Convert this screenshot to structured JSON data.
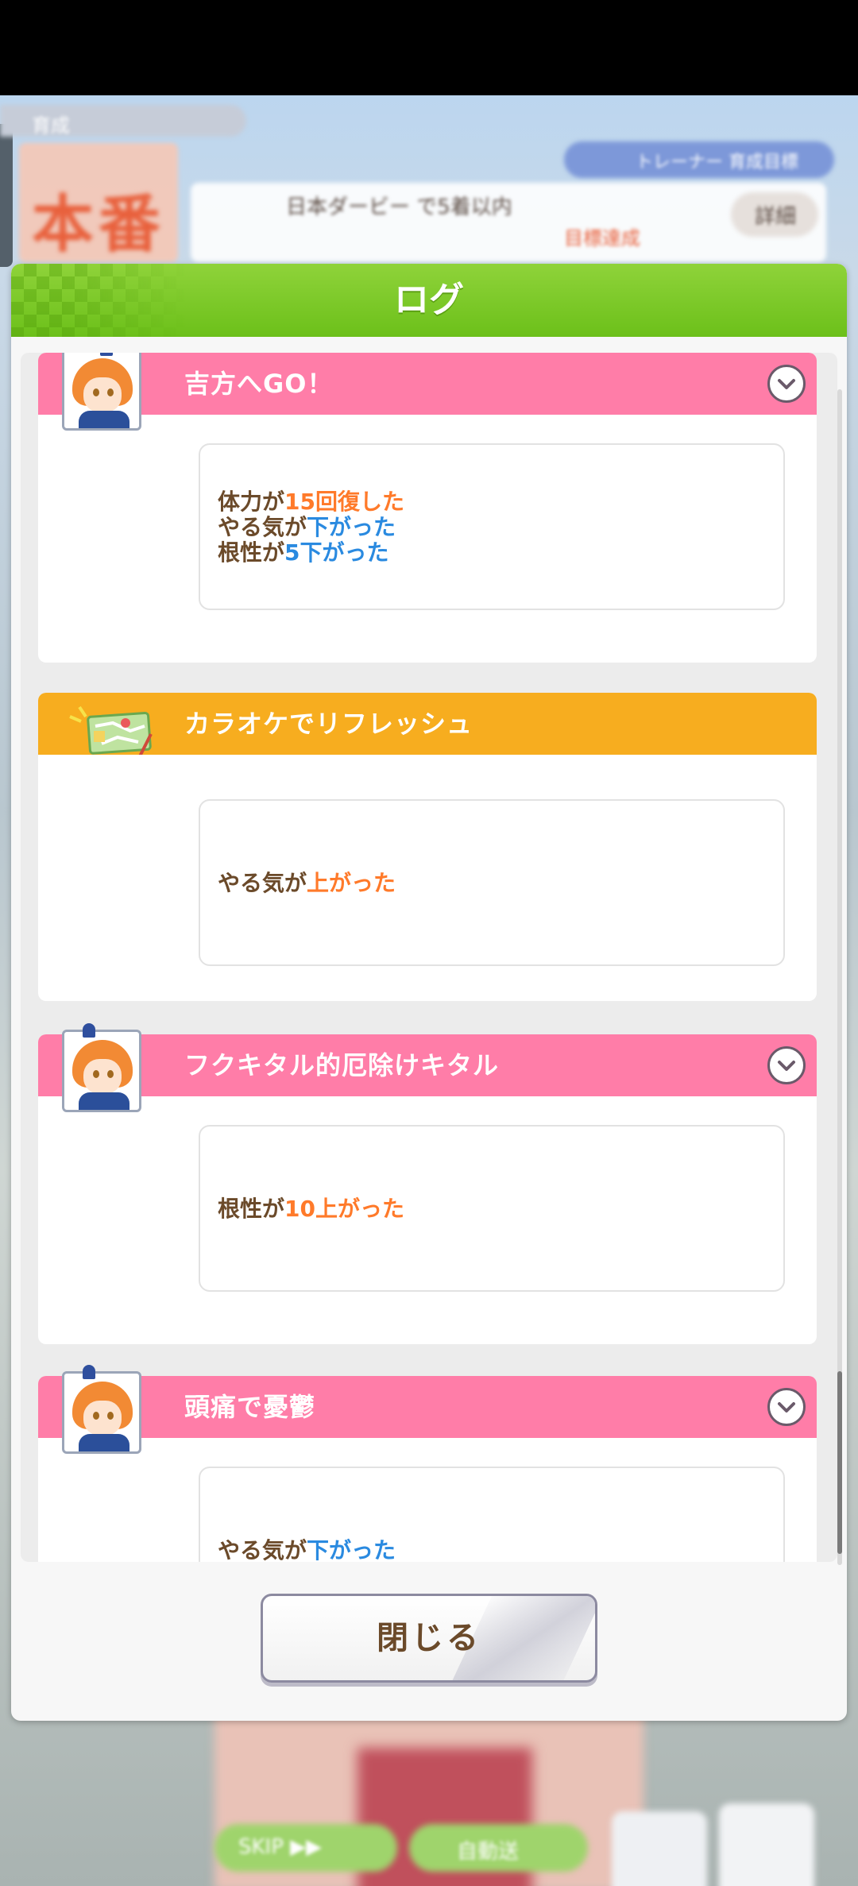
{
  "background": {
    "top_chip": "育成",
    "big_text": "本番",
    "trainer_badge": "トレーナー 育成目標",
    "goal_text": "日本ダービー で5着以内",
    "goal_red": "目標達成",
    "goal_button": "詳細",
    "skip_button": "SKIP ▶▶",
    "auto_button": "自動送"
  },
  "dialog": {
    "title": "ログ",
    "close_label": "閉じる"
  },
  "entries": [
    {
      "title": "吉方へGO！",
      "effects": [
        [
          {
            "t": "体力が",
            "c": "normal"
          },
          {
            "t": "15回復した",
            "c": "up"
          }
        ],
        [
          {
            "t": "やる気が",
            "c": "normal"
          },
          {
            "t": "下がった",
            "c": "down"
          }
        ],
        [
          {
            "t": "根性が",
            "c": "normal"
          },
          {
            "t": "5下がった",
            "c": "down"
          }
        ]
      ]
    },
    {
      "title": "カラオケでリフレッシュ",
      "effects": [
        [
          {
            "t": "やる気が",
            "c": "normal"
          },
          {
            "t": "上がった",
            "c": "up"
          }
        ]
      ]
    },
    {
      "title": "フクキタル的厄除けキタル",
      "effects": [
        [
          {
            "t": "根性が",
            "c": "normal"
          },
          {
            "t": "10上がった",
            "c": "up"
          }
        ]
      ]
    },
    {
      "title": "頭痛で憂鬱",
      "effects": [
        [
          {
            "t": "やる気が",
            "c": "normal"
          },
          {
            "t": "下がった",
            "c": "down"
          }
        ]
      ]
    }
  ],
  "colors": {
    "header_green": "#7cc52a",
    "entry_pink": "#ff7da8",
    "entry_orange": "#f7ad1f",
    "value_up": "#ff7a2a",
    "value_down": "#2a8ae0",
    "text_brown": "#6b4a2a"
  },
  "icons": {
    "chevron": "chevron-down-icon",
    "character": "character-portrait-icon",
    "event": "karaoke-map-icon"
  }
}
